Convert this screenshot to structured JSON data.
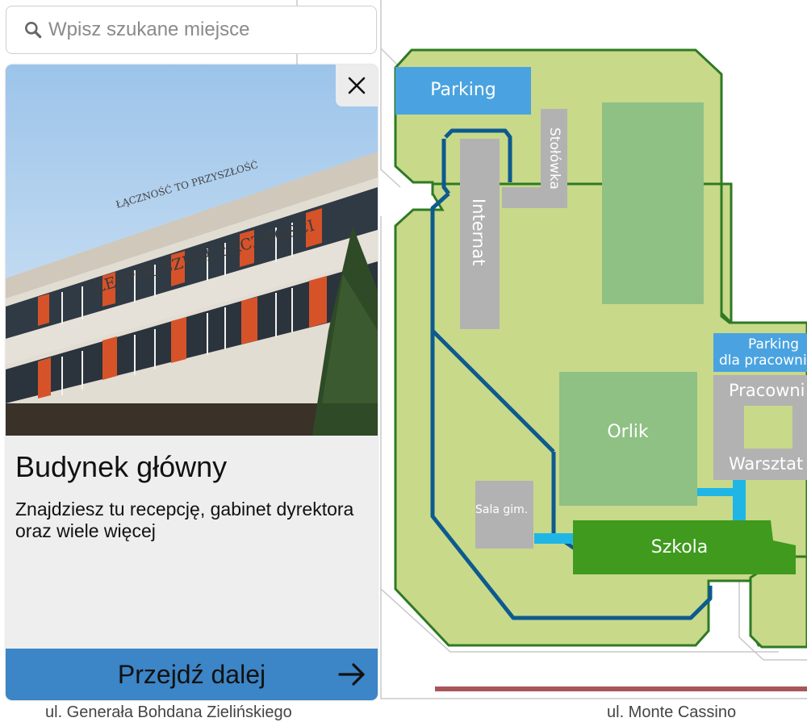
{
  "search": {
    "placeholder": "Wpisz szukane miejsce"
  },
  "card": {
    "photo_signs": {
      "line1": "ŁĄCZNOŚĆ TO PRZYSZŁOŚĆ",
      "line2": "ZESPÓŁ SZKÓŁ ŁĄCZNOŚCI"
    },
    "title": "Budynek główny",
    "description": "Znajdziesz tu recepcję, gabinet dyrektora oraz wiele więcej",
    "action_label": "Przejdź dalej",
    "close_icon": "close-icon",
    "action_icon": "arrow-right-icon"
  },
  "map": {
    "labels": {
      "parking": "Parking",
      "stolowka": "Stołówka",
      "internat": "Internat",
      "parking_staff_1": "Parking",
      "parking_staff_2": "dla pracowni",
      "pracownie": "Pracowni",
      "warsztaty": "Warsztat",
      "orlik": "Orlik",
      "sala_gim": "Sala gim.",
      "szkola": "Szkola"
    },
    "streets": {
      "left": "ul. Generała Bohdana Zielińskiego",
      "right": "ul. Monte Cassino"
    },
    "colors": {
      "grass": "#c8d98a",
      "field": "#8fc084",
      "building": "#b2b2b2",
      "school": "#3f9a1d",
      "parking": "#4aa3e0",
      "path": "#0d5a8e",
      "connector": "#1fb6e6",
      "border": "#2e7a24"
    }
  }
}
